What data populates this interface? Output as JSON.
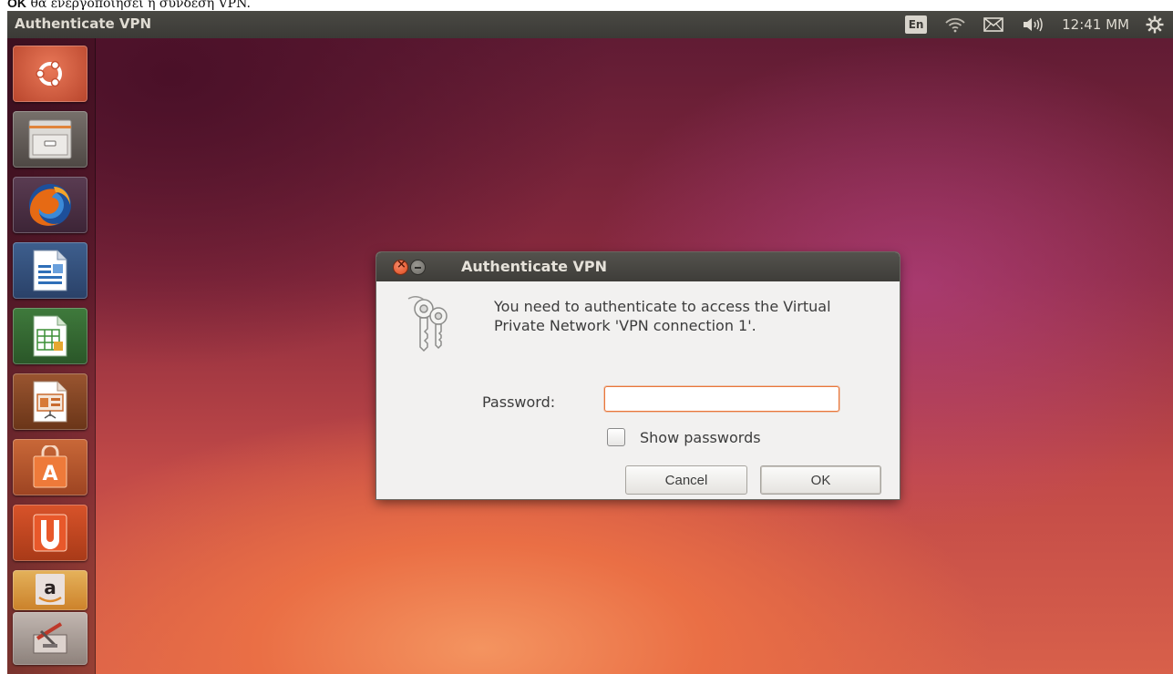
{
  "caption": {
    "bold_text": "OK",
    "text": " θα ενεργοποιήσει η σύνδεση VPN."
  },
  "top_panel": {
    "title": "Authenticate VPN",
    "language": "En",
    "clock": "12:41 MM",
    "icons": [
      "wifi-icon",
      "mail-icon",
      "volume-icon",
      "settings-gear-icon"
    ]
  },
  "launcher": {
    "items": [
      "ubuntu-dash",
      "files",
      "firefox",
      "libreoffice-writer",
      "libreoffice-calc",
      "libreoffice-impress",
      "ubuntu-software-center",
      "ubuntu-one",
      "amazon",
      "system-settings"
    ]
  },
  "dialog": {
    "title": "Authenticate VPN",
    "message": "You need to authenticate to access the Virtual Private Network 'VPN connection 1'.",
    "password_label": "Password:",
    "password_value": "",
    "show_passwords_label": "Show passwords",
    "show_passwords_checked": false,
    "cancel_label": "Cancel",
    "ok_label": "OK"
  },
  "colors": {
    "panel": "#3b3a36",
    "accent_orange": "#e9763a",
    "dialog_bg": "#f2f1f0"
  }
}
